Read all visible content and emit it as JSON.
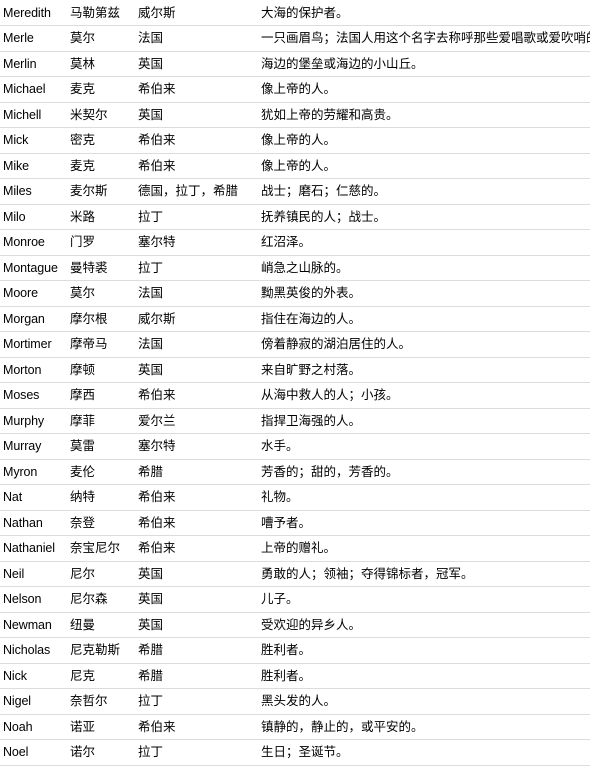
{
  "table": {
    "columns": [
      "name",
      "transliteration",
      "origin",
      "meaning"
    ],
    "rows": [
      {
        "name": "Meredith",
        "transliteration": "马勒第兹",
        "origin": "威尔斯",
        "meaning": "大海的保护者。"
      },
      {
        "name": "Merle",
        "transliteration": "莫尔",
        "origin": "法国",
        "meaning": "一只画眉鸟；法国人用这个名字去称呼那些爱唱歌或爱吹哨的人"
      },
      {
        "name": "Merlin",
        "transliteration": "莫林",
        "origin": "英国",
        "meaning": "海边的堡垒或海边的小山丘。"
      },
      {
        "name": "Michael",
        "transliteration": "麦克",
        "origin": "希伯来",
        "meaning": "像上帝的人。"
      },
      {
        "name": "Michell",
        "transliteration": "米契尔",
        "origin": "英国",
        "meaning": "犹如上帝的劳耀和高贵。"
      },
      {
        "name": "Mick",
        "transliteration": "密克",
        "origin": "希伯来",
        "meaning": "像上帝的人。"
      },
      {
        "name": "Mike",
        "transliteration": "麦克",
        "origin": "希伯来",
        "meaning": "像上帝的人。"
      },
      {
        "name": "Miles",
        "transliteration": "麦尔斯",
        "origin": "德国，拉丁，希腊",
        "meaning": "战士；磨石；仁慈的。"
      },
      {
        "name": "Milo",
        "transliteration": "米路",
        "origin": "拉丁",
        "meaning": "抚养镇民的人；战士。"
      },
      {
        "name": "Monroe",
        "transliteration": "门罗",
        "origin": "塞尔特",
        "meaning": "红沼泽。"
      },
      {
        "name": "Montague",
        "transliteration": "曼特裘",
        "origin": "拉丁",
        "meaning": "峭急之山脉的。"
      },
      {
        "name": "Moore",
        "transliteration": "莫尔",
        "origin": "法国",
        "meaning": "黝黑英俊的外表。"
      },
      {
        "name": "Morgan",
        "transliteration": "摩尔根",
        "origin": "威尔斯",
        "meaning": "指住在海边的人。"
      },
      {
        "name": "Mortimer",
        "transliteration": "摩帝马",
        "origin": "法国",
        "meaning": "傍着静寂的湖泊居住的人。"
      },
      {
        "name": "Morton",
        "transliteration": "摩顿",
        "origin": "英国",
        "meaning": "来自旷野之村落。"
      },
      {
        "name": "Moses",
        "transliteration": "摩西",
        "origin": "希伯来",
        "meaning": "从海中救人的人；小孩。"
      },
      {
        "name": "Murphy",
        "transliteration": "摩菲",
        "origin": "爱尔兰",
        "meaning": "指捍卫海强的人。"
      },
      {
        "name": "Murray",
        "transliteration": "莫雷",
        "origin": "塞尔特",
        "meaning": "水手。"
      },
      {
        "name": "Myron",
        "transliteration": "麦伦",
        "origin": "希腊",
        "meaning": "芳香的；甜的，芳香的。"
      },
      {
        "name": "Nat",
        "transliteration": "纳特",
        "origin": "希伯来",
        "meaning": "礼物。"
      },
      {
        "name": "Nathan",
        "transliteration": "奈登",
        "origin": "希伯来",
        "meaning": "嘈予者。"
      },
      {
        "name": "Nathaniel",
        "transliteration": "奈宝尼尔",
        "origin": "希伯来",
        "meaning": "上帝的赠礼。"
      },
      {
        "name": "Neil",
        "transliteration": "尼尔",
        "origin": "英国",
        "meaning": "勇敢的人；领袖；夺得锦标者，冠军。"
      },
      {
        "name": "Nelson",
        "transliteration": "尼尔森",
        "origin": "英国",
        "meaning": "儿子。"
      },
      {
        "name": "Newman",
        "transliteration": "纽曼",
        "origin": "英国",
        "meaning": "受欢迎的异乡人。"
      },
      {
        "name": "Nicholas",
        "transliteration": "尼克勒斯",
        "origin": "希腊",
        "meaning": "胜利者。"
      },
      {
        "name": "Nick",
        "transliteration": "尼克",
        "origin": "希腊",
        "meaning": "胜利者。"
      },
      {
        "name": "Nigel",
        "transliteration": "奈哲尔",
        "origin": "拉丁",
        "meaning": "黑头发的人。"
      },
      {
        "name": "Noah",
        "transliteration": "诺亚",
        "origin": "希伯来",
        "meaning": "镇静的，静止的，或平安的。"
      },
      {
        "name": "Noel",
        "transliteration": "诺尔",
        "origin": "拉丁",
        "meaning": "生日；圣诞节。"
      }
    ]
  },
  "colors": {
    "background": "#ffffff",
    "text": "#000000",
    "row_divider": "#dcdcdc"
  }
}
